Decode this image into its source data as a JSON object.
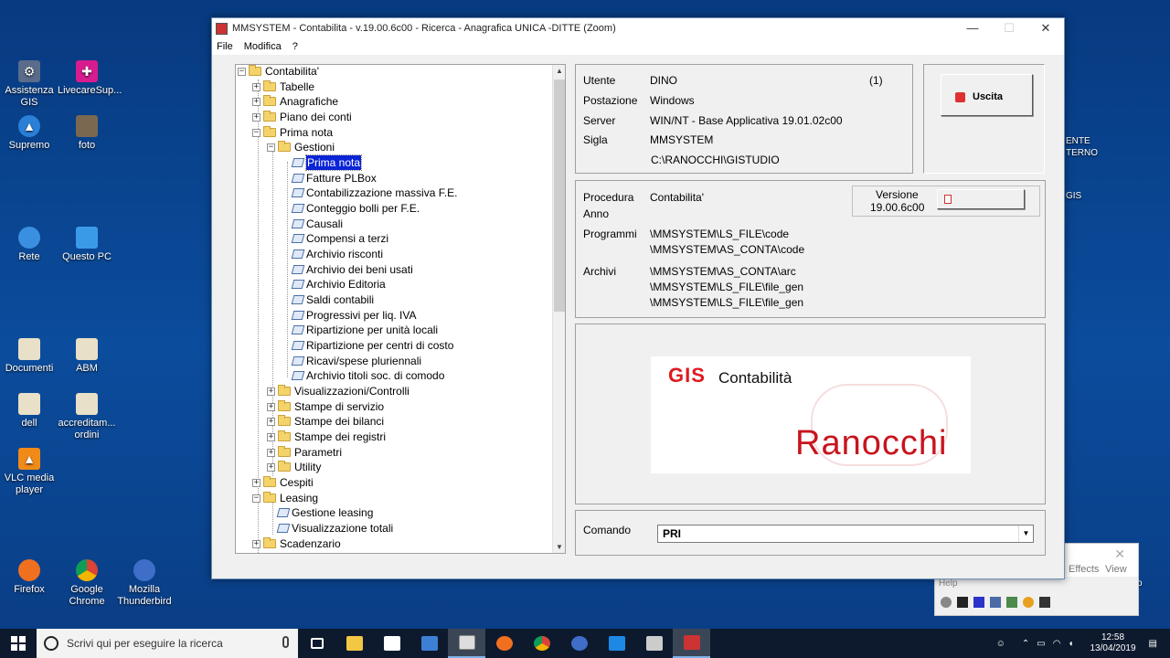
{
  "desktop": {
    "icons": [
      {
        "name": "assistenza-gis",
        "label": "Assistenza GIS",
        "color": "#5a6c8a"
      },
      {
        "name": "livecare",
        "label": "LivecareSup...",
        "color": "#d81b8f"
      },
      {
        "name": "supremo",
        "label": "Supremo",
        "color": "#2a7fd6"
      },
      {
        "name": "foto",
        "label": "foto",
        "color": "#7a6850"
      },
      {
        "name": "rete",
        "label": "Rete",
        "color": "#3b8fe0"
      },
      {
        "name": "questo-pc",
        "label": "Questo PC",
        "color": "#3b9ae8"
      },
      {
        "name": "documenti",
        "label": "Documenti",
        "color": "#e8e0c8"
      },
      {
        "name": "abm",
        "label": "ABM",
        "color": "#e8e0c8"
      },
      {
        "name": "dell",
        "label": "dell",
        "color": "#e8e0c8"
      },
      {
        "name": "accreditam",
        "label": "accreditam... ordini",
        "color": "#e8e0c8"
      },
      {
        "name": "vlc",
        "label": "VLC media player",
        "color": "#f08a18"
      },
      {
        "name": "firefox",
        "label": "Firefox",
        "color": "#f07020"
      },
      {
        "name": "chrome",
        "label": "Google Chrome",
        "color": "#3aa757"
      },
      {
        "name": "thunderbird",
        "label": "Mozilla Thunderbird",
        "color": "#3f6ec8"
      }
    ],
    "side_text": {
      "ente": "ENTE",
      "terno": "TERNO",
      "gis": "GIS",
      "o": "o"
    },
    "bg_window": {
      "effects": "Effects",
      "view": "View",
      "help": "Help"
    }
  },
  "window": {
    "title": "MMSYSTEM - Contabilita - v.19.00.6c00 - Ricerca - Anagrafica UNICA -DITTE (Zoom)",
    "menu": [
      "File",
      "Modifica",
      "?"
    ]
  },
  "tree": {
    "root": "Contabilita'",
    "l1": [
      "Tabelle",
      "Anagrafiche",
      "Piano dei conti",
      "Prima nota"
    ],
    "gestioni": "Gestioni",
    "gestioni_items": [
      "Prima nota",
      "Fatture PLBox",
      "Contabilizzazione massiva F.E.",
      "Conteggio bolli per F.E.",
      "Causali",
      "Compensi a terzi",
      "Archivio risconti",
      "Archivio dei beni usati",
      "Archivio Editoria",
      "Saldi contabili",
      "Progressivi per liq. IVA",
      "Ripartizione per unità locali",
      "Ripartizione per centri di costo",
      "Ricavi/spese pluriennali",
      "Archivio titoli soc. di comodo"
    ],
    "l2_after": [
      "Visualizzazioni/Controlli",
      "Stampe di servizio",
      "Stampe dei bilanci",
      "Stampe dei registri",
      "Parametri",
      "Utility"
    ],
    "cespiti": "Cespiti",
    "leasing": "Leasing",
    "leasing_items": [
      "Gestione leasing",
      "Visualizzazione totali"
    ],
    "scadenzario": "Scadenzario"
  },
  "info": {
    "utente_label": "Utente",
    "utente": "DINO",
    "count": "(1)",
    "postazione_label": "Postazione",
    "postazione": "Windows",
    "server_label": "Server",
    "server": "WIN/NT - Base Applicativa 19.01.02c00",
    "sigla_label": "Sigla",
    "sigla": "MMSYSTEM",
    "path": "C:\\RANOCCHI\\GISTUDIO"
  },
  "exit_button": "Uscita",
  "procedura": {
    "procedura_label": "Procedura",
    "procedura": "Contabilita'",
    "anno_label": "Anno",
    "versione_label": "Versione",
    "versione": "19.00.6c00",
    "programmi_label": "Programmi",
    "programmi": [
      "\\MMSYSTEM\\LS_FILE\\code",
      "\\MMSYSTEM\\AS_CONTA\\code"
    ],
    "archivi_label": "Archivi",
    "archivi": [
      "\\MMSYSTEM\\AS_CONTA\\arc",
      "\\MMSYSTEM\\LS_FILE\\file_gen",
      "\\MMSYSTEM\\LS_FILE\\file_gen"
    ]
  },
  "logo": {
    "gis": "GIS",
    "contabilita": "Contabilità",
    "ranocchi": "Ranocchi"
  },
  "comando": {
    "label": "Comando",
    "value": "PRI"
  },
  "taskbar": {
    "search_placeholder": "Scrivi qui per eseguire la ricerca",
    "time": "12:58",
    "date": "13/04/2019"
  },
  "colors": {
    "selection": "#0a24d6",
    "brand_red": "#e0191f",
    "desktop": "#0b4c9c"
  }
}
